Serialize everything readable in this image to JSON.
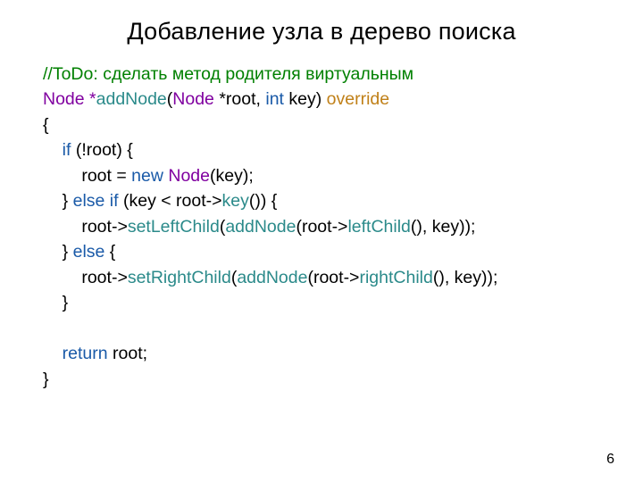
{
  "title": "Добавление узла в дерево поиска",
  "page_number": "6",
  "code": {
    "l1_comment": "//ToDo: сделать метод родителя виртуальным",
    "l2": {
      "t1": "Node *",
      "t2": "addNode",
      "t3": "(",
      "t4": "Node",
      "t5": " *root, ",
      "t6": "int",
      "t7": " key) ",
      "t8": "override"
    },
    "l3": "{",
    "l4": {
      "indent": "    ",
      "t1": "if",
      "t2": " (!root) {"
    },
    "l5": {
      "indent": "        ",
      "t1": "root = ",
      "t2": "new",
      "t3": " ",
      "t4": "Node",
      "t5": "(key);"
    },
    "l6": {
      "indent": "    ",
      "t1": "} ",
      "t2": "else if",
      "t3": " (key < root->",
      "t4": "key",
      "t5": "()) {"
    },
    "l7": {
      "indent": "        ",
      "t1": "root->",
      "t2": "setLeftChild",
      "t3": "(",
      "t4": "addNode",
      "t5": "(root->",
      "t6": "leftChild",
      "t7": "(), key));"
    },
    "l8": {
      "indent": "    ",
      "t1": "} ",
      "t2": "else",
      "t3": " {"
    },
    "l9": {
      "indent": "        ",
      "t1": "root->",
      "t2": "setRightChild",
      "t3": "(",
      "t4": "addNode",
      "t5": "(root->",
      "t6": "rightChild",
      "t7": "(), key));"
    },
    "l10": {
      "indent": "    ",
      "t1": "}"
    },
    "l11": "",
    "l12": {
      "indent": "    ",
      "t1": "return",
      "t2": " root;"
    },
    "l13": "}"
  }
}
